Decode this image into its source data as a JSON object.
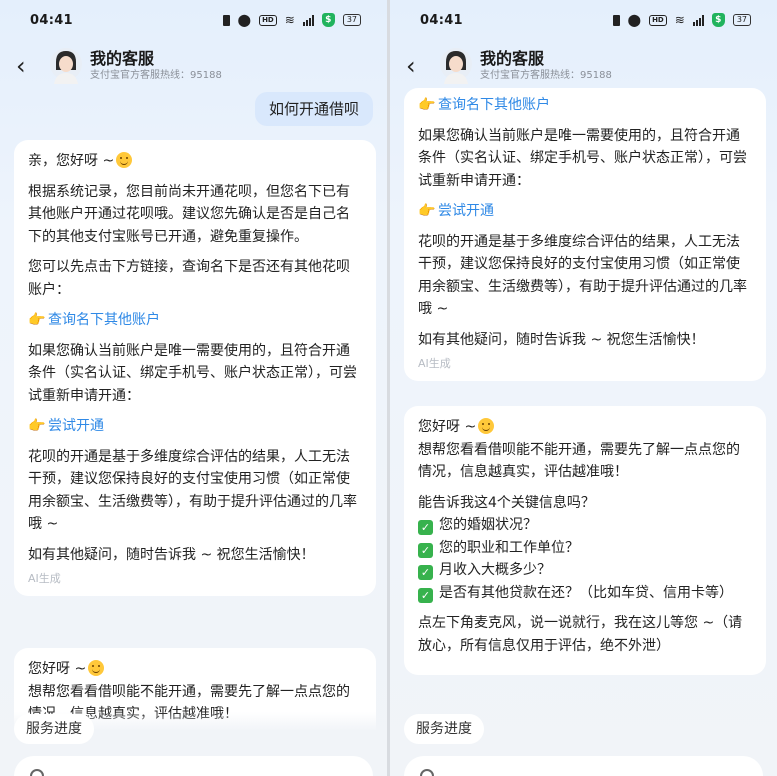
{
  "status": {
    "time": "04:41",
    "battery": "37"
  },
  "header": {
    "title": "我的客服",
    "subtitle": "支付宝官方客服热线：95188"
  },
  "chat": {
    "user_msg": "如何开通借呗",
    "reply1": {
      "greeting": "亲，您好呀 ~",
      "p1": "根据系统记录，您目前尚未开通花呗，但您名下已有其他账户开通过花呗哦。建议您先确认是否是自己名下的其他支付宝账号已开通，避免重复操作。",
      "p2": "您可以先点击下方链接，查询名下是否还有其他花呗账户：",
      "link1": "查询名下其他账户",
      "p3": "如果您确认当前账户是唯一需要使用的，且符合开通条件（实名认证、绑定手机号、账户状态正常），可尝试重新申请开通：",
      "link2": "尝试开通",
      "p4": "花呗的开通是基于多维度综合评估的结果，人工无法干预，建议您保持良好的支付宝使用习惯（如正常使用余额宝、生活缴费等），有助于提升评估通过的几率哦 ~",
      "p5": "如有其他疑问，随时告诉我 ~ 祝您生活愉快！",
      "ai_tag": "AI生成"
    },
    "reply2": {
      "greeting": "您好呀 ~",
      "intro": "想帮您看看借呗能不能开通，需要先了解一点点您的情况，信息越真实，评估越准哦！",
      "question": "能告诉我这4个关键信息吗？",
      "items": [
        "您的婚姻状况？",
        "您的职业和工作单位？",
        "月收入大概多少？",
        "是否有其他贷款在还？（比如车贷、信用卡等）"
      ],
      "closing": "点左下角麦克风，说一说就行，我在这儿等您 ~（请放心，所有信息仅用于评估，绝不外泄）"
    }
  },
  "bottom": {
    "service_progress": "服务进度"
  }
}
